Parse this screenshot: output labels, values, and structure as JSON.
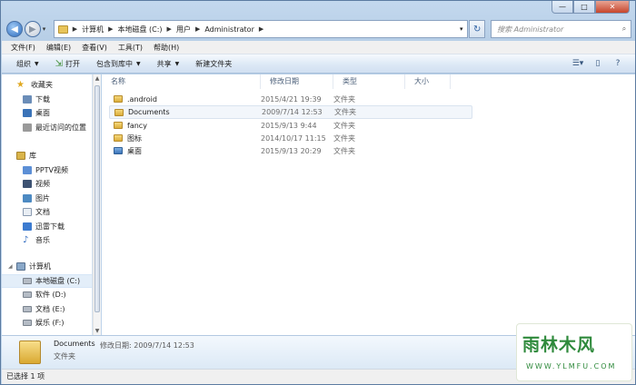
{
  "window": {
    "controls": {
      "minimize": "—",
      "maximize": "□",
      "close": "✕"
    }
  },
  "address_bar": {
    "crumbs": [
      "计算机",
      "本地磁盘 (C:)",
      "用户",
      "Administrator"
    ],
    "search_placeholder": "搜索 Administrator"
  },
  "menu": [
    "文件(F)",
    "编辑(E)",
    "查看(V)",
    "工具(T)",
    "帮助(H)"
  ],
  "toolbar": {
    "organize": "组织",
    "open": "打开",
    "include_library": "包含到库中",
    "share": "共享",
    "new_folder": "新建文件夹"
  },
  "nav": {
    "favorites": {
      "label": "收藏夹",
      "items": [
        "下载",
        "桌面",
        "最近访问的位置"
      ]
    },
    "libraries": {
      "label": "库",
      "items": [
        "PPTV视频",
        "视频",
        "图片",
        "文档",
        "迅雷下载",
        "音乐"
      ]
    },
    "computer": {
      "label": "计算机",
      "items": [
        "本地磁盘 (C:)",
        "软件 (D:)",
        "文档 (E:)",
        "娱乐 (F:)"
      ]
    }
  },
  "columns": {
    "name": "名称",
    "date": "修改日期",
    "type": "类型",
    "size": "大小"
  },
  "files": [
    {
      "name": ".android",
      "date": "2015/4/21 19:39",
      "type": "文件夹",
      "icon": "folder-icon"
    },
    {
      "name": "Documents",
      "date": "2009/7/14 12:53",
      "type": "文件夹",
      "icon": "folder-icon"
    },
    {
      "name": "fancy",
      "date": "2015/9/13 9:44",
      "type": "文件夹",
      "icon": "folder-icon"
    },
    {
      "name": "图标",
      "date": "2014/10/17 11:15",
      "type": "文件夹",
      "icon": "folder-icon"
    },
    {
      "name": "桌面",
      "date": "2015/9/13 20:29",
      "type": "文件夹",
      "icon": "desktop-folder-icon"
    }
  ],
  "details": {
    "name": "Documents",
    "modified": "修改日期: 2009/7/14 12:53",
    "type": "文件夹"
  },
  "status": "已选择 1 项",
  "watermark": {
    "title": "雨林木风",
    "url": "WWW.YLMFU.COM"
  }
}
